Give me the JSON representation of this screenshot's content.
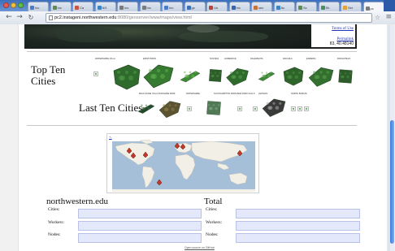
{
  "browser": {
    "tabs": [
      {
        "label": "Inc",
        "color": "#4a7cc7"
      },
      {
        "label": "Inc",
        "color": "#5d8d4a"
      },
      {
        "label": "Ca",
        "color": "#c8533f"
      },
      {
        "label": "NG",
        "color": "#3a83c4"
      },
      {
        "label": "Inc",
        "color": "#7a7a7a"
      },
      {
        "label": "Inc",
        "color": "#7a7a7a"
      },
      {
        "label": "Inc",
        "color": "#4a7cc7"
      },
      {
        "label": "gc",
        "color": "#3a6fb8"
      },
      {
        "label": "Un",
        "color": "#b8473a"
      },
      {
        "label": "Inc",
        "color": "#3565b0"
      },
      {
        "label": "sec",
        "color": "#c9703a"
      },
      {
        "label": "Ac",
        "color": "#3a83c4"
      },
      {
        "label": "Sc",
        "color": "#5d8d4a"
      },
      {
        "label": "Sh",
        "color": "#4a8f5a"
      },
      {
        "label": "Ser",
        "color": "#e0a23a"
      },
      {
        "label": "pc",
        "color": "#7a7a7a"
      }
    ],
    "url_host": "pc2.instageni.northwestern.edu",
    "url_path": ":8080/geoserver/www/maps/view.html"
  },
  "header": {
    "terms_link": "Terms of Use",
    "permalink": "Permalink",
    "coords": "83, 40.48140"
  },
  "top_ten": {
    "heading": "Top Ten Cities",
    "labels": [
      "WATERSHIRE VILLA",
      "EDISTOWNN",
      "NOVHDA",
      "HOMEWICE",
      "DALEMANTA",
      "WACHILA",
      "ENDERIA",
      "PANSHITEVA"
    ],
    "tiles": [
      {
        "color": "#2f6b2c",
        "shade": "#4f9a45",
        "shape": "leaf"
      },
      {
        "color": "#367a30",
        "shade": "#5fae4f",
        "shape": "wide"
      },
      {
        "color": "#3e8a34",
        "shade": "#6bb85a",
        "shape": "sliver"
      },
      {
        "color": "#2d5e2a",
        "shade": "#4c8c40",
        "shape": "block"
      },
      {
        "color": "#2f6a2d",
        "shade": "#56a04a",
        "shape": "wide"
      },
      {
        "color": "#3f8a36",
        "shade": "#6ab15a",
        "shape": "sliver"
      },
      {
        "color": "#2e6429",
        "shade": "#4f9445",
        "shape": "leaf"
      },
      {
        "color": "#33702f",
        "shade": "#5aa24d",
        "shape": "wide"
      },
      {
        "color": "#2c5c29",
        "shade": "#4c8a42",
        "shape": "block"
      }
    ]
  },
  "last_ten": {
    "heading": "Last Ten Cities",
    "labels": [
      "BACK-DUNE VILLA SUNSHINE PARK",
      "WATERSHIRE",
      "SOUTHAMPTON PARKVIEW PARK FALLS",
      "LEONHIV",
      "NORTH BURUNI"
    ],
    "tiles": [
      {
        "color": "#25482a",
        "shade": "#3d6a3f",
        "shape": "sliver"
      },
      {
        "color": "#5c5430",
        "shade": "#8a7d48",
        "shape": "wide"
      },
      {
        "color": "#4f7a54",
        "shade": "#7fa783",
        "shape": "block"
      },
      {
        "color": "#3a3a3a",
        "shade": "#a7a7a7",
        "shape": "wide"
      }
    ]
  },
  "map": {
    "zoom_label": "+-"
  },
  "stats": {
    "site_title": "northwestern.edu",
    "total_title": "Total",
    "cities_label": "Cities:",
    "workers_label": "Workers:",
    "nodes_label": "Nodes:",
    "site_cities": "",
    "site_workers": "",
    "site_nodes": "",
    "total_cities": "",
    "total_workers": "",
    "total_nodes": ""
  },
  "footer": {
    "source_link": "Open source on GitHub"
  }
}
